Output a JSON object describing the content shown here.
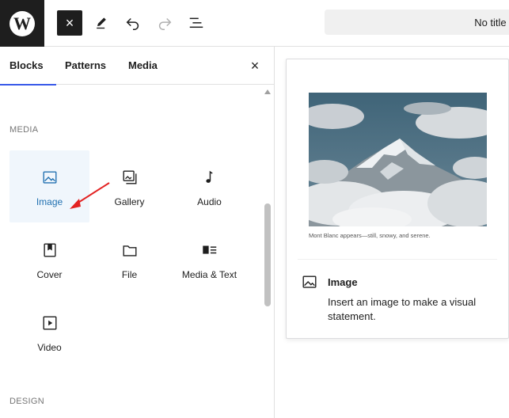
{
  "toolbar": {
    "logo_letter": "W",
    "close_label": "×",
    "document_title": "No title",
    "document_title_suffix": "·"
  },
  "inserter": {
    "tabs": [
      {
        "label": "Blocks",
        "active": true
      },
      {
        "label": "Patterns",
        "active": false
      },
      {
        "label": "Media",
        "active": false
      }
    ],
    "close_label": "×",
    "sections": [
      {
        "title": "MEDIA",
        "blocks": [
          {
            "label": "Image",
            "icon": "image-icon",
            "active": true
          },
          {
            "label": "Gallery",
            "icon": "gallery-icon",
            "active": false
          },
          {
            "label": "Audio",
            "icon": "audio-icon",
            "active": false
          },
          {
            "label": "Cover",
            "icon": "cover-icon",
            "active": false
          },
          {
            "label": "File",
            "icon": "file-icon",
            "active": false
          },
          {
            "label": "Media & Text",
            "icon": "media-text-icon",
            "active": false
          },
          {
            "label": "Video",
            "icon": "video-icon",
            "active": false
          }
        ]
      },
      {
        "title": "DESIGN",
        "blocks": []
      }
    ]
  },
  "preview": {
    "caption": "Mont Blanc appears—still, snowy, and serene.",
    "block_title": "Image",
    "block_description": "Insert an image to make a visual statement.",
    "icon": "image-icon"
  },
  "colors": {
    "accent": "#3858e9",
    "active_block": "#2271b1",
    "active_bg": "#f0f6fc",
    "annotation": "#e32222"
  }
}
